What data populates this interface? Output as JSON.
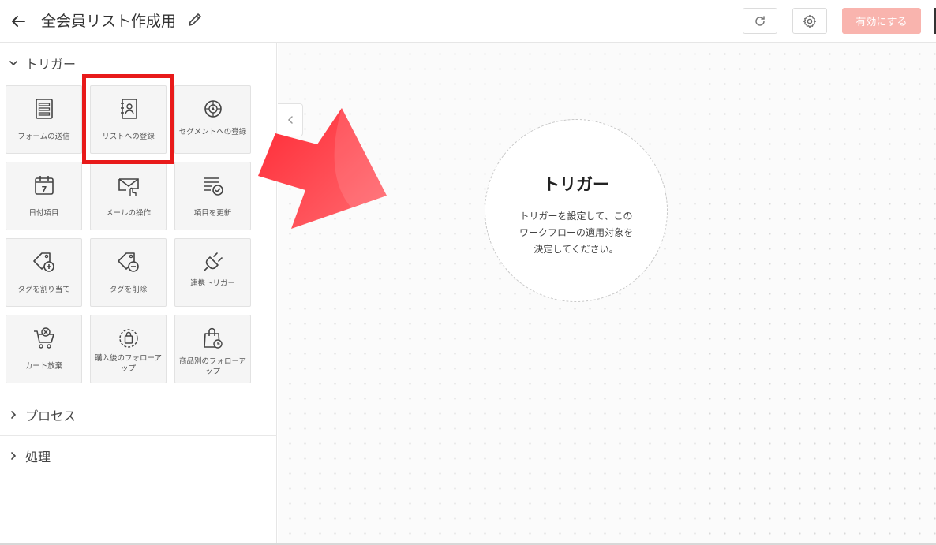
{
  "header": {
    "title": "全会員リスト作成用",
    "activate_label": "有効にする"
  },
  "sidebar": {
    "trigger_section": "トリガー",
    "process_section": "プロセス",
    "handling_section": "処理",
    "tiles": [
      {
        "label": "フォームの送信",
        "icon": "form-icon"
      },
      {
        "label": "リストへの登録",
        "icon": "contact-book-icon"
      },
      {
        "label": "セグメントへの登録",
        "icon": "segment-icon"
      },
      {
        "label": "日付項目",
        "icon": "calendar-icon",
        "badge": "7"
      },
      {
        "label": "メールの操作",
        "icon": "mail-click-icon"
      },
      {
        "label": "項目を更新",
        "icon": "update-fields-icon"
      },
      {
        "label": "タグを割り当て",
        "icon": "tag-add-icon"
      },
      {
        "label": "タグを削除",
        "icon": "tag-remove-icon"
      },
      {
        "label": "連携トリガー",
        "icon": "plug-icon"
      },
      {
        "label": "カート放棄",
        "icon": "cart-icon"
      },
      {
        "label": "購入後のフォローアップ",
        "icon": "purchase-followup-icon"
      },
      {
        "label": "商品別のフォローアップ",
        "icon": "product-followup-icon"
      }
    ]
  },
  "canvas": {
    "node_title": "トリガー",
    "node_desc_1": "トリガーを設定して、この",
    "node_desc_2": "ワークフローの適用対象を",
    "node_desc_3": "決定してください。"
  },
  "colors": {
    "accent": "#f9b4ae",
    "highlight": "#e81a1a",
    "arrow": "#ff3b42"
  }
}
